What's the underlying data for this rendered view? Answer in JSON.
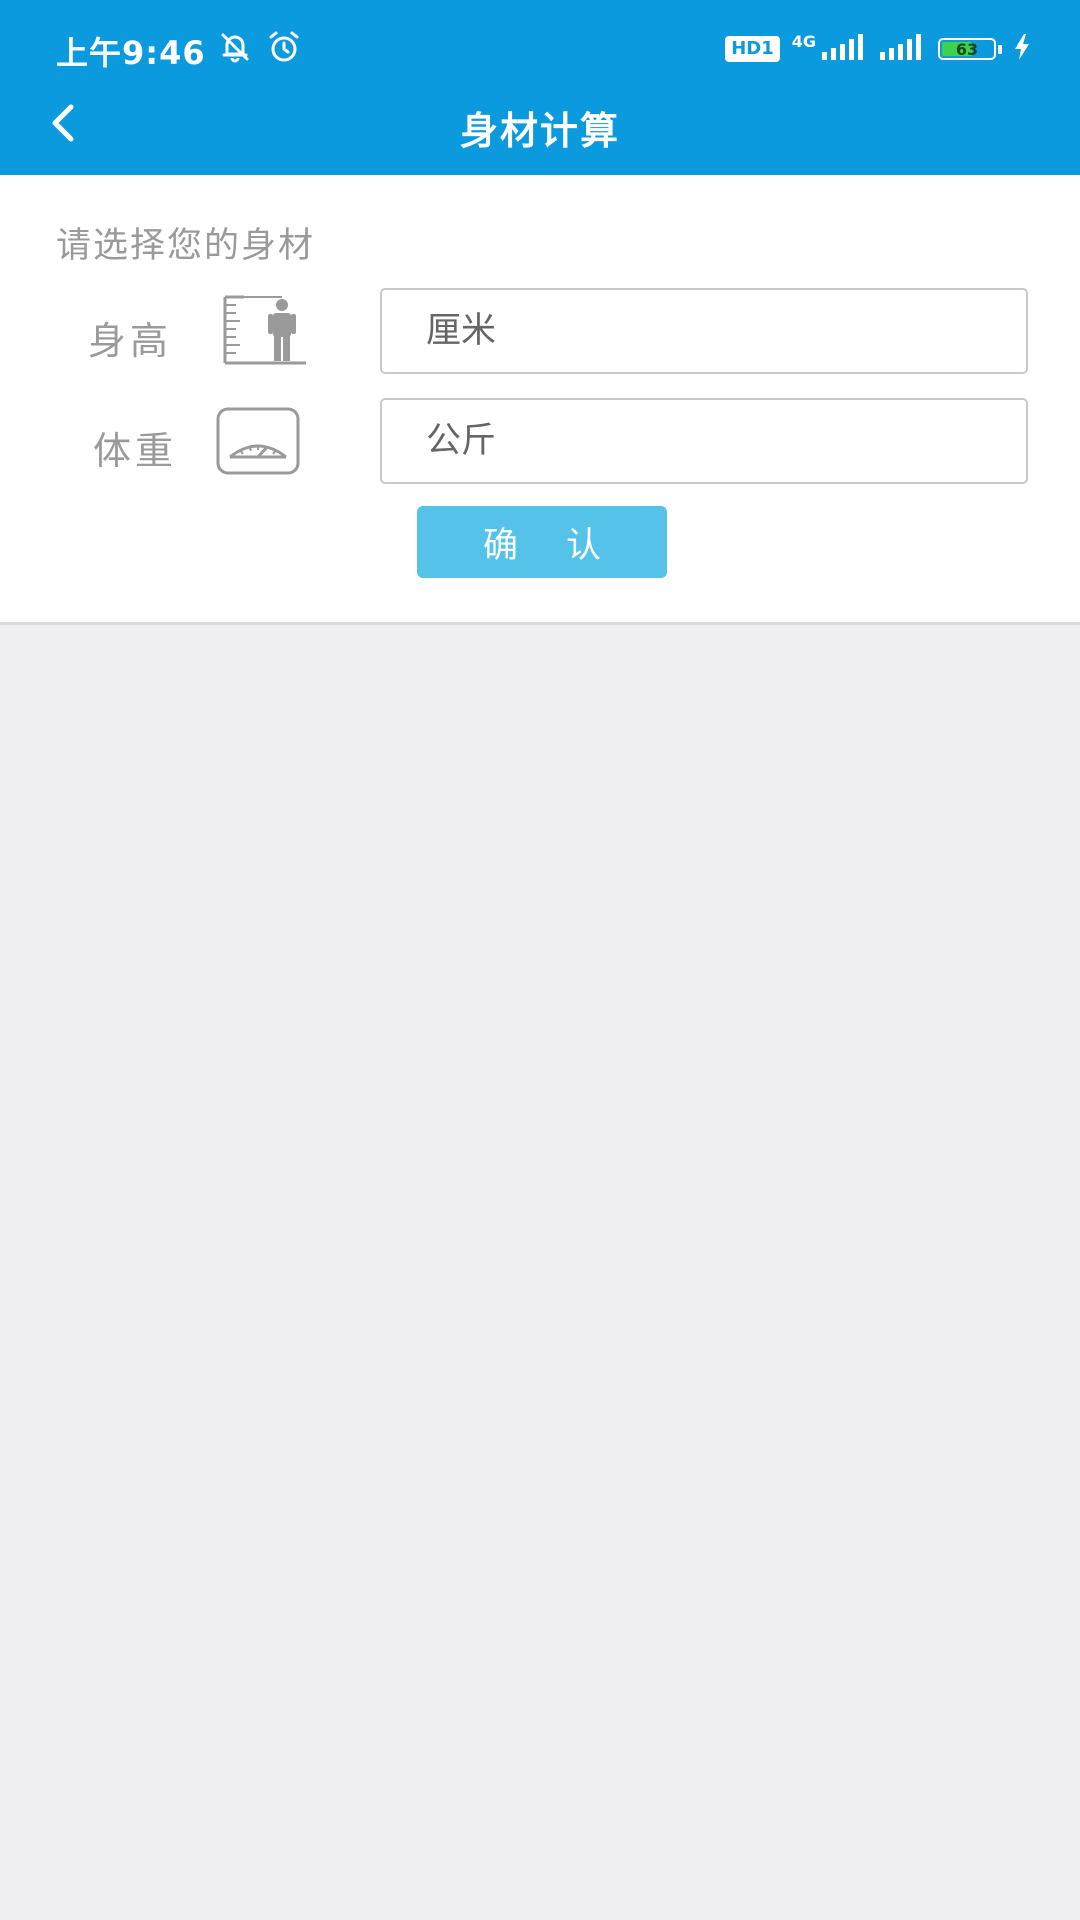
{
  "status_bar": {
    "time": "上午9:46",
    "hd_badge": "HD1",
    "network": "4G",
    "battery_level": "63",
    "battery_fraction": 0.63,
    "icons": [
      "bell-off-icon",
      "alarm-icon",
      "signal-icon",
      "signal-icon",
      "battery-icon",
      "charging-icon"
    ]
  },
  "nav": {
    "title": "身材计算",
    "back_icon": "chevron-left-icon"
  },
  "form": {
    "prompt": "请选择您的身材",
    "height": {
      "label": "身高",
      "icon": "height-ruler-icon",
      "placeholder": "厘米"
    },
    "weight": {
      "label": "体重",
      "icon": "scale-icon",
      "placeholder": "公斤"
    },
    "confirm_label": "确认"
  },
  "colors": {
    "header": "#0b9ade",
    "confirm_button": "#55c2ea",
    "background": "#efeff4",
    "label_gray": "#9a9a9a"
  }
}
